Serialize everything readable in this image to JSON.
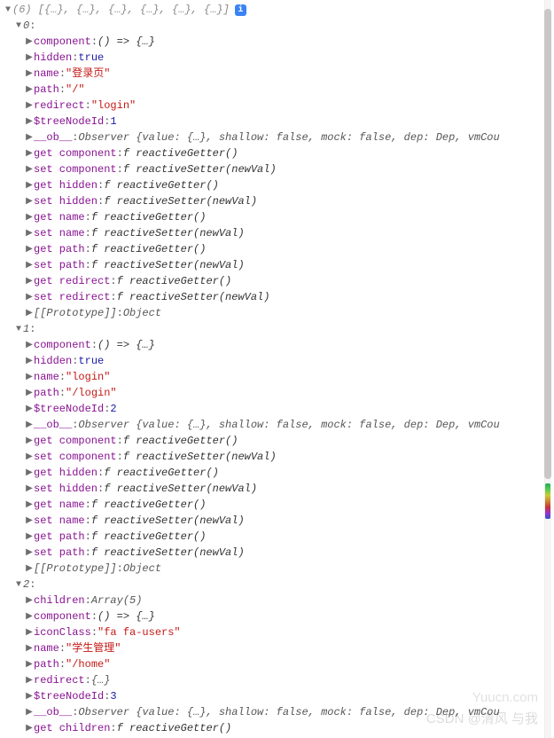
{
  "header": {
    "count": "(6)",
    "preview": "[{…}, {…}, {…}, {…}, {…}, {…}]"
  },
  "nodes": {
    "n0": {
      "idx": "0",
      "component": {
        "k": "component",
        "v": "() => {…}"
      },
      "hidden": {
        "k": "hidden",
        "v": "true"
      },
      "name": {
        "k": "name",
        "v": "\"登录页\""
      },
      "path": {
        "k": "path",
        "v": "\"/\""
      },
      "redirect": {
        "k": "redirect",
        "v": "\"login\""
      },
      "treeId": {
        "k": "$treeNodeId",
        "v": "1"
      },
      "ob": {
        "k": "__ob__",
        "v": "Observer {value: {…}, shallow: false, mock: false, dep: Dep, vmCou"
      },
      "getset": [
        {
          "k": "get component",
          "v": "f reactiveGetter()"
        },
        {
          "k": "set component",
          "v": "f reactiveSetter(newVal)"
        },
        {
          "k": "get hidden",
          "v": "f reactiveGetter()"
        },
        {
          "k": "set hidden",
          "v": "f reactiveSetter(newVal)"
        },
        {
          "k": "get name",
          "v": "f reactiveGetter()"
        },
        {
          "k": "set name",
          "v": "f reactiveSetter(newVal)"
        },
        {
          "k": "get path",
          "v": "f reactiveGetter()"
        },
        {
          "k": "set path",
          "v": "f reactiveSetter(newVal)"
        },
        {
          "k": "get redirect",
          "v": "f reactiveGetter()"
        },
        {
          "k": "set redirect",
          "v": "f reactiveSetter(newVal)"
        }
      ],
      "proto": {
        "k": "[[Prototype]]",
        "v": "Object"
      }
    },
    "n1": {
      "idx": "1",
      "component": {
        "k": "component",
        "v": "() => {…}"
      },
      "hidden": {
        "k": "hidden",
        "v": "true"
      },
      "name": {
        "k": "name",
        "v": "\"login\""
      },
      "path": {
        "k": "path",
        "v": "\"/login\""
      },
      "treeId": {
        "k": "$treeNodeId",
        "v": "2"
      },
      "ob": {
        "k": "__ob__",
        "v": "Observer {value: {…}, shallow: false, mock: false, dep: Dep, vmCou"
      },
      "getset": [
        {
          "k": "get component",
          "v": "f reactiveGetter()"
        },
        {
          "k": "set component",
          "v": "f reactiveSetter(newVal)"
        },
        {
          "k": "get hidden",
          "v": "f reactiveGetter()"
        },
        {
          "k": "set hidden",
          "v": "f reactiveSetter(newVal)"
        },
        {
          "k": "get name",
          "v": "f reactiveGetter()"
        },
        {
          "k": "set name",
          "v": "f reactiveSetter(newVal)"
        },
        {
          "k": "get path",
          "v": "f reactiveGetter()"
        },
        {
          "k": "set path",
          "v": "f reactiveSetter(newVal)"
        }
      ],
      "proto": {
        "k": "[[Prototype]]",
        "v": "Object"
      }
    },
    "n2": {
      "idx": "2",
      "children": {
        "k": "children",
        "v": "Array(5)"
      },
      "component": {
        "k": "component",
        "v": "() => {…}"
      },
      "iconClass": {
        "k": "iconClass",
        "v": "\"fa fa-users\""
      },
      "name": {
        "k": "name",
        "v": "\"学生管理\""
      },
      "path": {
        "k": "path",
        "v": "\"/home\""
      },
      "redirect": {
        "k": "redirect",
        "v": "{…}"
      },
      "treeId": {
        "k": "$treeNodeId",
        "v": "3"
      },
      "ob": {
        "k": "__ob__",
        "v": "Observer {value: {…}, shallow: false, mock: false, dep: Dep, vmCou"
      },
      "getset": [
        {
          "k": "get children",
          "v": "f reactiveGetter()"
        }
      ]
    }
  },
  "wm1": "Yuucn.com",
  "wm2": "CSDN @清风 与我"
}
